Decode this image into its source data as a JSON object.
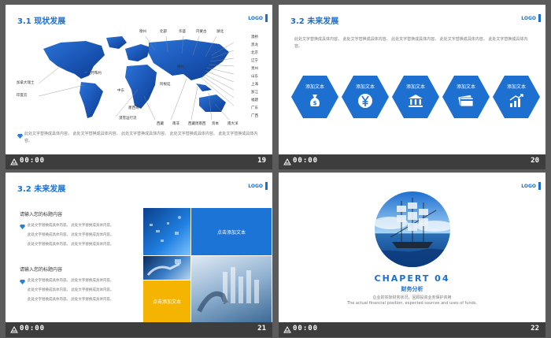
{
  "slides": [
    {
      "title": "3.1 现状发展",
      "logo": "LOGO",
      "time": "00:00",
      "number": "19",
      "map_labels_left": [
        "加拿大瑞士",
        "印度云"
      ],
      "map_labels_top": [
        "德州",
        "北部",
        "华盛",
        "内蒙古",
        "湖北"
      ],
      "map_labels_mid": [
        "纽约布约",
        "德州",
        "阿根廷",
        "中东",
        "墨西哥",
        "漠雪运行流"
      ],
      "map_labels_bottom": [
        "西藏",
        "南非",
        "西藏周南西",
        "资本",
        "南大洋"
      ],
      "map_labels_right": [
        "澳桥",
        "黑龙",
        "北京",
        "辽宁",
        "贵州",
        "山东",
        "上海",
        "浙江",
        "福建",
        "广东",
        "广西"
      ],
      "footnote": "此处文字替换成具体内容。 此处文字替换成具体内容。 此处文字替换成具体内容。 此处文字替换成具体内容。 此处文字替换成具体内容。",
      "colors": {
        "accent": "#1a6fd1",
        "map": "#1f5fbf"
      }
    },
    {
      "title": "3.2 未来发展",
      "logo": "LOGO",
      "time": "00:00",
      "number": "20",
      "body": "此处文字替换成具体内容。 此处文字替换成具体内容。 此处文字替换成具体内容。 此处文字替换成具体内容。 此处文字替换成具体内容。",
      "hexes": [
        {
          "label": "添加文本",
          "icon": "money-bag-icon",
          "color": "#1d6fd0"
        },
        {
          "label": "添加文本",
          "icon": "yen-icon",
          "color": "#1d6fd0"
        },
        {
          "label": "添加文本",
          "icon": "bank-icon",
          "color": "#1d6fd0"
        },
        {
          "label": "添加文本",
          "icon": "card-icon",
          "color": "#1d6fd0"
        },
        {
          "label": "添加文本",
          "icon": "growth-chart-icon",
          "color": "#1d6fd0"
        }
      ]
    },
    {
      "title": "3.2 未来发展",
      "logo": "LOGO",
      "time": "00:00",
      "number": "21",
      "sections": [
        {
          "heading": "请输入您的标题内容",
          "lines": [
            "此处文字替换成具体内容。 此处文字替换成具体内容。",
            "此处文字替换成具体内容。 此处文字替换成具体内容。",
            "此处文字替换成具体内容。 此处文字替换成具体内容。"
          ]
        },
        {
          "heading": "请输入您的标题内容",
          "lines": [
            "此处文字替换成具体内容。 此处文字替换成具体内容。",
            "此处文字替换成具体内容。 此处文字替换成具体内容。",
            "此处文字替换成具体内容。 此处文字替换成具体内容。"
          ]
        }
      ],
      "blue_box_label": "点击添加文本",
      "yellow_box_label": "点击添加文本",
      "colors": {
        "blue": "#1b74d6",
        "yellow": "#f5b400"
      }
    },
    {
      "logo": "LOGO",
      "time": "00:00",
      "number": "22",
      "chapter": "CHAPERT  04",
      "chapter_title": "财务分析",
      "chapter_cn_sub": "企业的实际财务状况，回顾投资业务保护资用",
      "chapter_en_sub": "The actual financial position, expected sources and uses of funds."
    }
  ]
}
